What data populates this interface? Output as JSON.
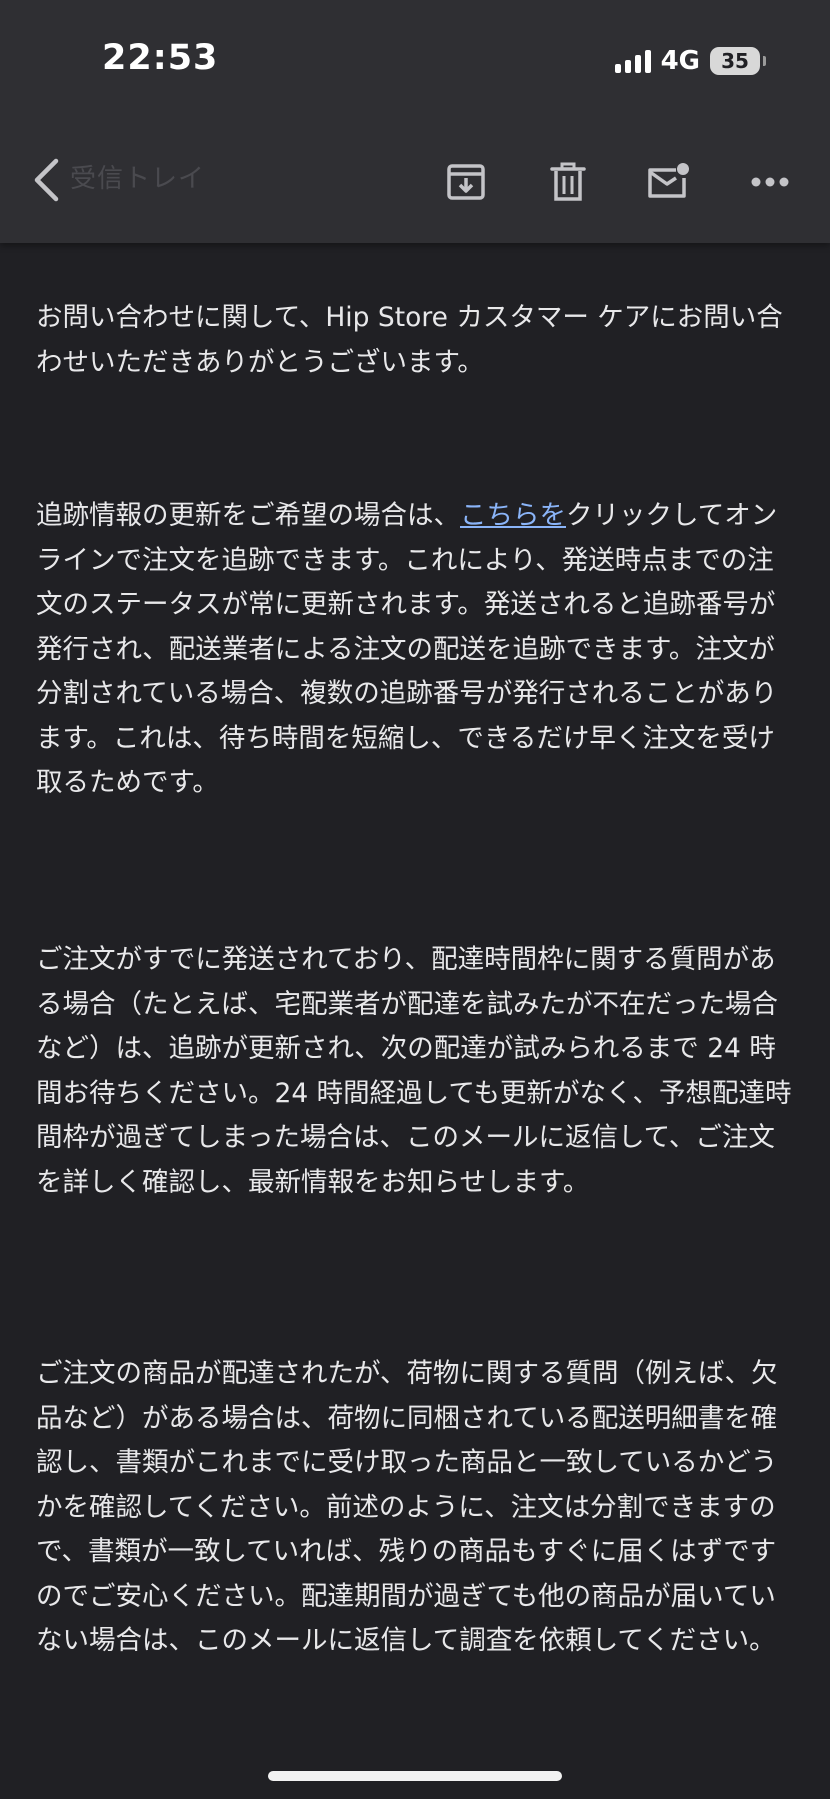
{
  "status_bar": {
    "time": "22:53",
    "network": "4G",
    "battery": "35"
  },
  "header": {
    "back_label": "受信トレイ",
    "icons": [
      "back-arrow-icon",
      "archive-icon",
      "trash-icon",
      "mark-unread-icon",
      "more-icon"
    ]
  },
  "email": {
    "paragraph1": "お問い合わせに関して、Hip Store カスタマー ケアにお問い合わせいただきありがとうございます。",
    "paragraph2_before_link": "追跡情報の更新をご希望の場合は、",
    "paragraph2_link": "こちらを",
    "paragraph2_after_link": "クリックしてオンラインで注文を追跡できます。これにより、発送時点までの注文のステータスが常に更新されます。発送されると追跡番号が発行され、配送業者による注文の配送を追跡できます。注文が分割されている場合、複数の追跡番号が発行されることがあります。これは、待ち時間を短縮し、できるだけ早く注文を受け取るためです。",
    "paragraph3": "ご注文がすでに発送されており、配達時間枠に関する質問がある場合（たとえば、宅配業者が配達を試みたが不在だった場合など）は、追跡が更新され、次の配達が試みられるまで 24 時間お待ちください。24 時間経過しても更新がなく、予想配達時間枠が過ぎてしまった場合は、このメールに返信して、ご注文を詳しく確認し、最新情報をお知らせします。",
    "paragraph4": "ご注文の商品が配達されたが、荷物に関する質問（例えば、欠品など）がある場合は、荷物に同梱されている配送明細書を確認し、書類がこれまでに受け取った商品と一致しているかどうかを確認してください。前述のように、注文は分割できますので、書類が一致していれば、残りの商品もすぐに届くはずですのでご安心ください。配達期間が過ぎても他の商品が届いていない場合は、このメールに返信して調査を依頼してください。"
  },
  "colors": {
    "background": "#202024",
    "header": "#2f2f33",
    "text": "#e8e8ea",
    "link": "#8ab4f8",
    "icon": "#c4c4c8"
  }
}
